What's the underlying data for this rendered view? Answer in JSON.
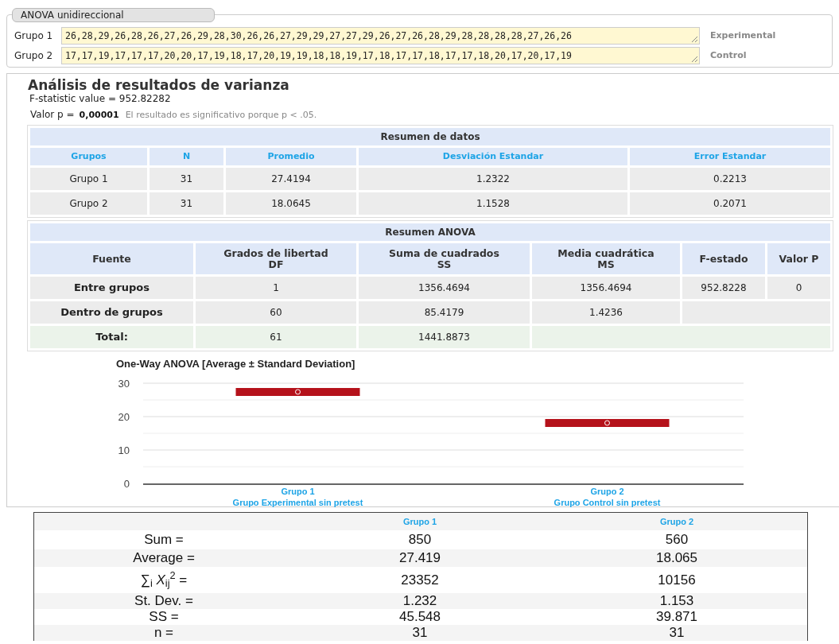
{
  "input_panel": {
    "legend": "ANOVA unidireccional",
    "groups": [
      {
        "label": "Grupo 1",
        "value": "26,28,29,26,28,26,27,26,29,28,30,26,26,27,29,29,27,27,29,26,27,26,28,29,28,28,28,28,27,26,26",
        "name": "Experimental"
      },
      {
        "label": "Grupo 2",
        "value": "17,17,19,17,17,17,20,20,17,19,18,17,20,19,19,18,18,19,17,18,17,17,18,17,17,18,20,17,20,17,19",
        "name": "Control"
      }
    ]
  },
  "results": {
    "title": "Análisis de resultados de varianza",
    "f_statistic": "F-statistic value = 952.82282",
    "p_label": "Valor p =",
    "p_value": "0,00001",
    "p_note": "El resultado es significativo porque p < .05.",
    "summary_table": {
      "title": "Resumen de datos",
      "columns": [
        "Grupos",
        "N",
        "Promedio",
        "Desviación Estandar",
        "Error Estandar"
      ],
      "rows": [
        [
          "Grupo 1",
          "31",
          "27.4194",
          "1.2322",
          "0.2213"
        ],
        [
          "Grupo 2",
          "31",
          "18.0645",
          "1.1528",
          "0.2071"
        ]
      ]
    },
    "anova_table": {
      "title": "Resumen ANOVA",
      "columns": [
        "Fuente",
        "Grados de libertad\nDF",
        "Suma de cuadrados\nSS",
        "Media cuadrática\nMS",
        "F-estado",
        "Valor P"
      ],
      "rows": [
        {
          "kind": "normal",
          "cells": [
            "Entre grupos",
            "1",
            "1356.4694",
            "1356.4694",
            "952.8228",
            "0"
          ]
        },
        {
          "kind": "normal",
          "cells": [
            "Dentro de grupos",
            "60",
            "85.4179",
            "1.4236"
          ]
        },
        {
          "kind": "total",
          "cells": [
            "Total:",
            "61",
            "1441.8873"
          ]
        }
      ]
    },
    "chart": {
      "chart_data": {
        "type": "scatter",
        "title": "One-Way ANOVA [Average ± Standard Deviation]",
        "categories": [
          "Grupo 1\nGrupo Experimental sin pretest",
          "Grupo 2\nGrupo Control sin pretest"
        ],
        "series": [
          {
            "color": "#b5121b",
            "values": [
              27.4,
              18.1
            ],
            "errors": [
              1.2,
              1.2
            ]
          }
        ],
        "ylim": [
          0,
          30
        ],
        "yticks": [
          0,
          10,
          20,
          30
        ]
      }
    }
  },
  "stats_table": {
    "columns": [
      "Grupo 1",
      "Grupo 2"
    ],
    "rows": [
      {
        "label": "Sum =",
        "values": [
          "850",
          "560"
        ]
      },
      {
        "label": "Average =",
        "values": [
          "27.419",
          "18.065"
        ]
      },
      {
        "label": "∑$_{i}$ *X*$_{ij}$$^{2}$ =",
        "values": [
          "23352",
          "10156"
        ]
      },
      {
        "label": "St. Dev. =",
        "values": [
          "1.232",
          "1.153"
        ]
      },
      {
        "label": "SS =",
        "values": [
          "45.548",
          "39.871"
        ]
      },
      {
        "label": "n =",
        "values": [
          "31",
          "31"
        ]
      }
    ]
  }
}
